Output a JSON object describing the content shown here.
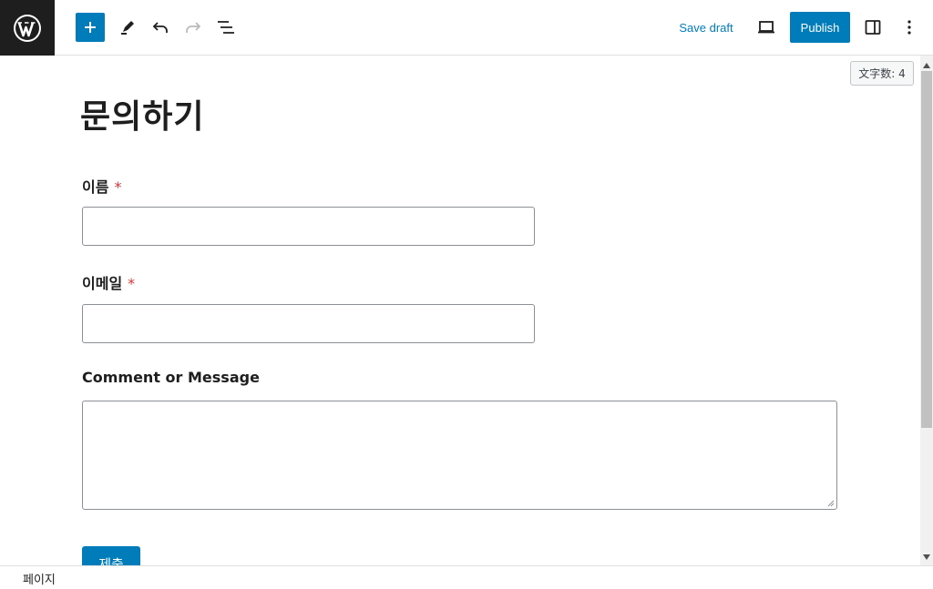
{
  "toolbar": {
    "save_draft_label": "Save draft",
    "publish_label": "Publish"
  },
  "editor": {
    "word_count": "文字数: 4",
    "page_title": "문의하기"
  },
  "form": {
    "name_label": "이름",
    "email_label": "이메일",
    "required_mark": "*",
    "message_label": "Comment or Message",
    "submit_label": "제출"
  },
  "footer": {
    "breadcrumb": "페이지"
  },
  "colors": {
    "accent": "#007cba",
    "required": "#d63638",
    "logo_bg": "#1e1e1e"
  }
}
